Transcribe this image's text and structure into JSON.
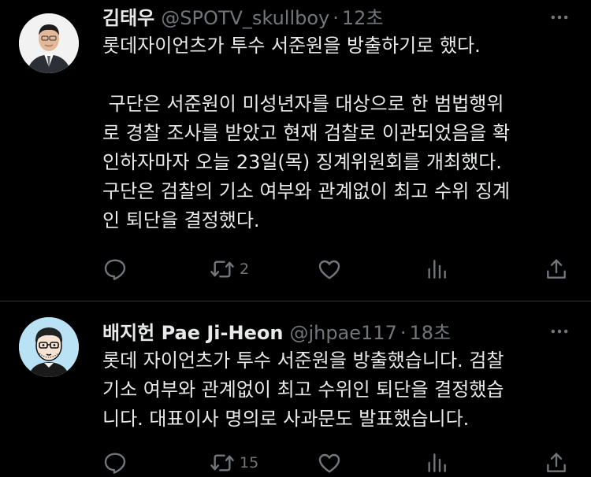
{
  "colors": {
    "background": "#000000",
    "text_primary": "#e7e9ea",
    "text_secondary": "#71767b",
    "divider": "#2f3336"
  },
  "tweets": [
    {
      "display_name": "김태우",
      "handle": "@SPOTV_skullboy",
      "separator": "·",
      "time": "12초",
      "body_lines": [
        "롯데자이언츠가 투수 서준원을 방출하기로 했다.",
        "",
        " 구단은 서준원이 미성년자를 대상으로 한 범법행위",
        "로 경찰 조사를 받았고 현재 검찰로 이관되었음을 확",
        "인하자마자 오늘 23일(목) 징계위원회를 개최했다.",
        "구단은 검찰의 기소 여부와 관계없이 최고 수위 징계",
        "인 퇴단을 결정했다."
      ],
      "actions": {
        "reply_icon": "reply-icon",
        "retweet_icon": "retweet-icon",
        "retweet_count": "2",
        "like_icon": "heart-icon",
        "views_icon": "views-icon",
        "share_icon": "share-icon"
      }
    },
    {
      "display_name": "배지헌 Pae Ji-Heon",
      "handle": "@jhpae117",
      "separator": "·",
      "time": "18초",
      "body_lines": [
        "롯데 자이언츠가 투수 서준원을 방출했습니다. 검찰",
        "기소 여부와 관계없이 최고 수위인 퇴단을 결정했습",
        "니다. 대표이사 명의로 사과문도 발표했습니다."
      ],
      "actions": {
        "reply_icon": "reply-icon",
        "retweet_icon": "retweet-icon",
        "retweet_count": "15",
        "like_icon": "heart-icon",
        "views_icon": "views-icon",
        "share_icon": "share-icon"
      }
    }
  ]
}
